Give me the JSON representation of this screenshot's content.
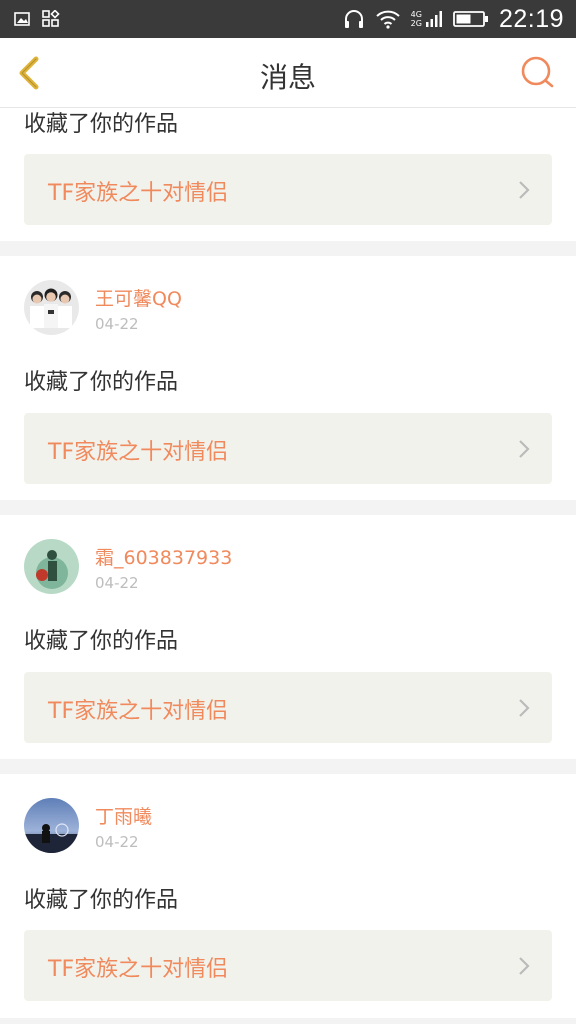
{
  "status_bar": {
    "time": "22:19",
    "network_top": "4G",
    "network_bottom": "2G",
    "icons": [
      "image-icon",
      "app-grid-icon",
      "headphones-icon",
      "wifi-icon",
      "signal-icon",
      "battery-icon"
    ]
  },
  "nav": {
    "title": "消息",
    "back_icon": "chevron-left-icon",
    "search_icon": "search-icon",
    "accent": "#f08a5d",
    "back_color": "#e0b43a"
  },
  "notifications": [
    {
      "action": "收藏了你的作品",
      "work_title": "TF家族之十对情侣"
    },
    {
      "username": "王可馨QQ",
      "date": "04-22",
      "action": "收藏了你的作品",
      "work_title": "TF家族之十对情侣"
    },
    {
      "username": "霜_603837933",
      "date": "04-22",
      "action": "收藏了你的作品",
      "work_title": "TF家族之十对情侣"
    },
    {
      "username": "丁雨曦",
      "date": "04-22",
      "action": "收藏了你的作品",
      "work_title": "TF家族之十对情侣"
    }
  ]
}
